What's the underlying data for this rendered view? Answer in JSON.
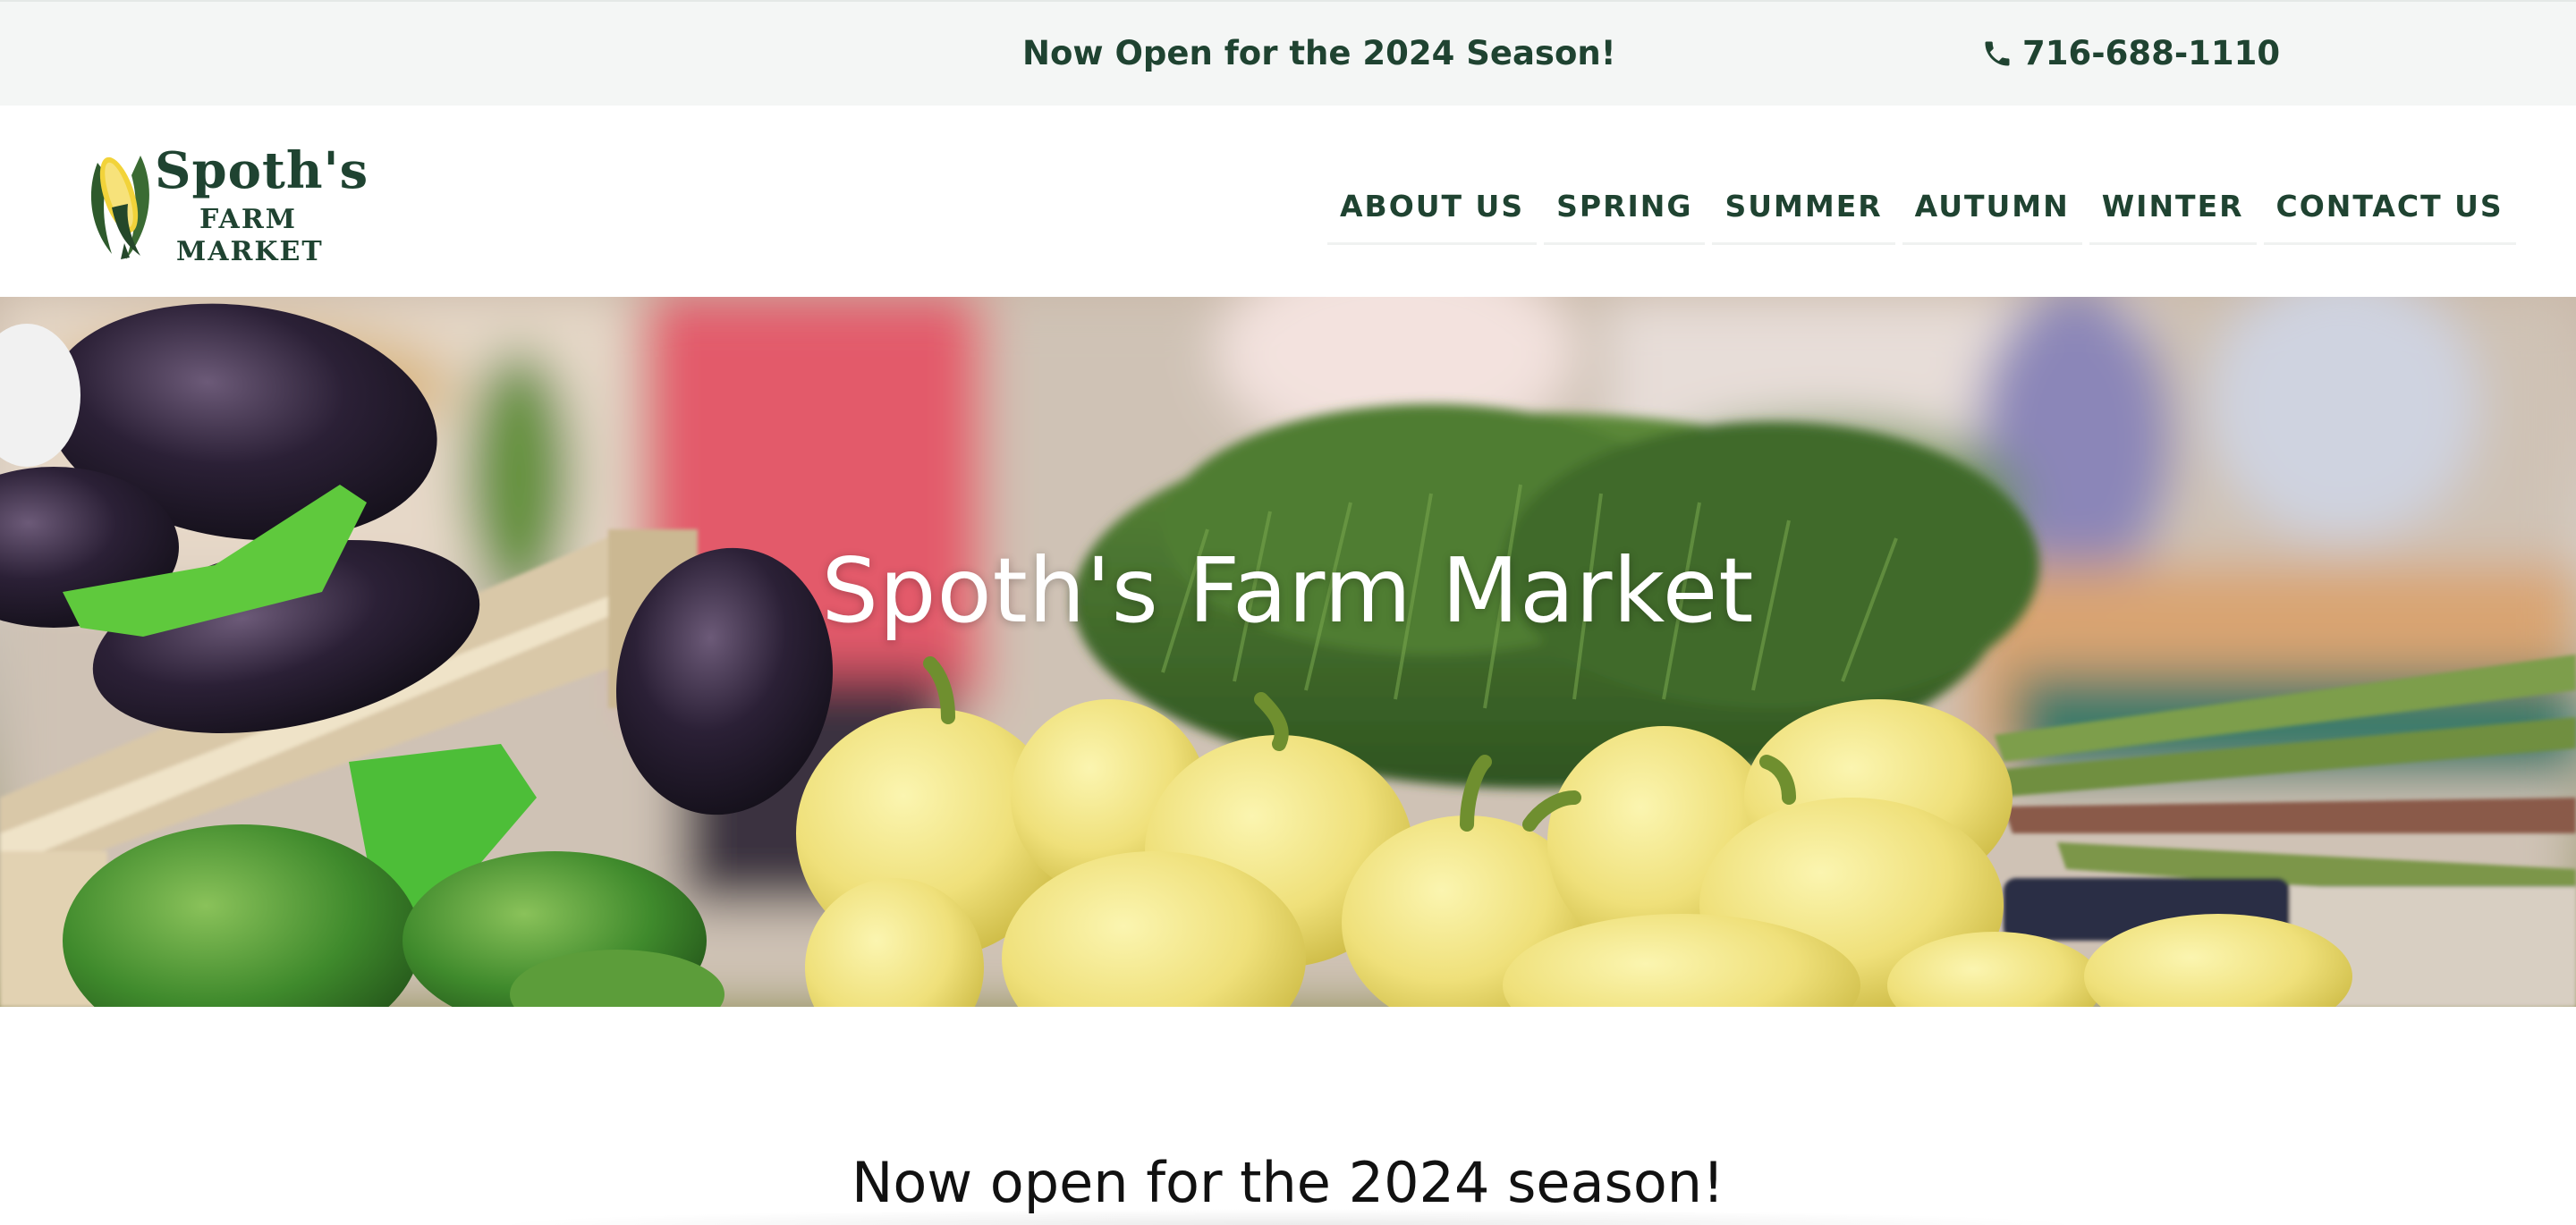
{
  "topbar": {
    "announcement": "Now Open for the 2024 Season!",
    "phone": "716-688-1110",
    "phone_icon": "phone-icon"
  },
  "logo": {
    "line1": "Spoth's",
    "line2": "FARM",
    "line3": "MARKET",
    "icon": "corn-icon"
  },
  "nav": {
    "items": [
      {
        "label": "ABOUT US"
      },
      {
        "label": "SPRING"
      },
      {
        "label": "SUMMER"
      },
      {
        "label": "AUTUMN"
      },
      {
        "label": "WINTER"
      },
      {
        "label": "CONTACT US"
      }
    ]
  },
  "hero": {
    "title": "Spoth's Farm Market"
  },
  "main": {
    "heading": "Now open for the 2024 season!"
  },
  "colors": {
    "brand_green": "#1f4331",
    "topbar_bg": "#f4f6f5"
  }
}
